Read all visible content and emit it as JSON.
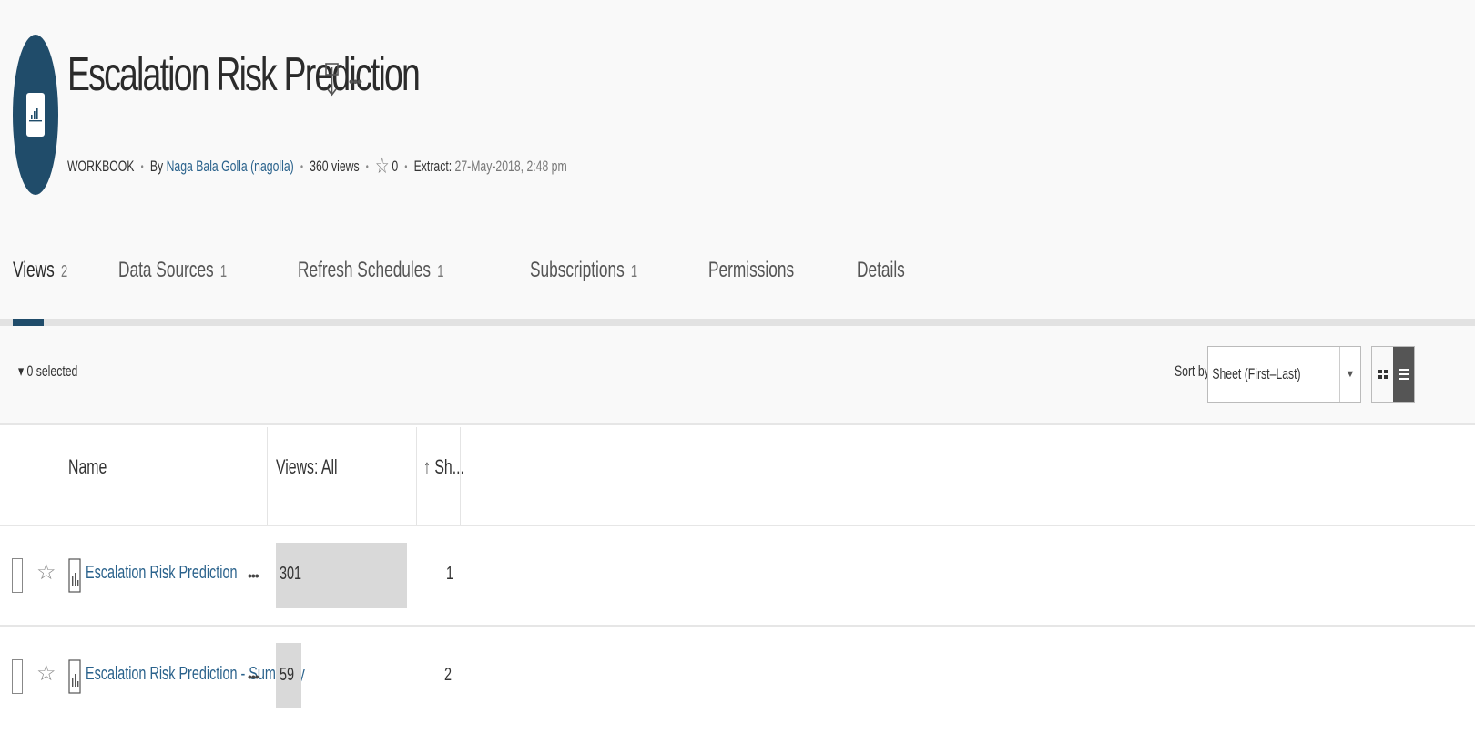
{
  "workbook": {
    "title": "Escalation Risk Prediction",
    "type_label": "WORKBOOK",
    "by_label": "By",
    "author": "Naga Bala Golla (nagolla)",
    "views_text": "360 views",
    "favorites_count": "0",
    "extract_label": "Extract:",
    "extract_date": "27-May-2018, 2:48 pm",
    "more_label": "•••"
  },
  "tabs": [
    {
      "label": "Views",
      "count": "2",
      "active": true
    },
    {
      "label": "Data Sources",
      "count": "1"
    },
    {
      "label": "Refresh Schedules",
      "count": "1"
    },
    {
      "label": "Subscriptions",
      "count": "1"
    },
    {
      "label": "Permissions",
      "count": ""
    },
    {
      "label": "Details",
      "count": ""
    }
  ],
  "toolbar": {
    "selected_text": "▾ 0 selected",
    "sort_by_label": "Sort by",
    "sort_value": "Sheet (First–Last)",
    "view_mode": "list"
  },
  "table": {
    "columns": {
      "name": "Name",
      "views": "Views: All",
      "sheet": "↑ Sh..."
    },
    "views_max": 301,
    "rows": [
      {
        "name": "Escalation Risk Prediction",
        "views": 301,
        "views_text": "301",
        "sheet": "1"
      },
      {
        "name": "Escalation Risk Prediction - Summary",
        "views": 59,
        "views_text": "59",
        "sheet": "2"
      }
    ]
  },
  "colors": {
    "accent": "#204c6a",
    "link": "#2a628c",
    "bar": "#d9d9d9"
  }
}
